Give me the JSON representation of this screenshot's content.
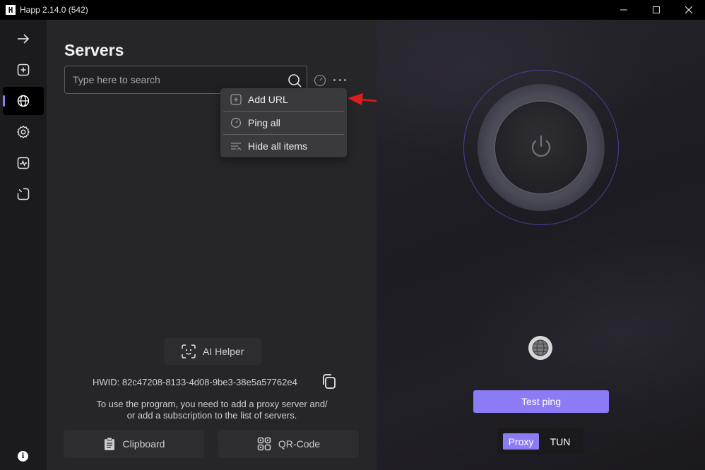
{
  "window": {
    "title": "Happ 2.14.0 (542)",
    "logo_text": "H"
  },
  "colors": {
    "accent": "#8b7cf6",
    "annotation_arrow": "#e01b1b",
    "panel_bg": "#262628",
    "sidebar_bg": "#1b1b1d"
  },
  "sidebar": {
    "items": [
      {
        "icon": "arrow-right-icon",
        "active": false
      },
      {
        "icon": "plus-square-icon",
        "active": false
      },
      {
        "icon": "globe-icon",
        "active": true
      },
      {
        "icon": "gear-icon",
        "active": false
      },
      {
        "icon": "activity-icon",
        "active": false
      },
      {
        "icon": "timer-icon",
        "active": false
      }
    ],
    "info_glyph": "i"
  },
  "servers": {
    "title": "Servers",
    "search_placeholder": "Type here to search"
  },
  "menu": {
    "items": [
      {
        "label": "Add URL",
        "icon": "add-box-icon"
      },
      {
        "label": "Ping all",
        "icon": "gauge-icon"
      },
      {
        "label": "Hide all items",
        "icon": "hide-list-icon"
      }
    ]
  },
  "empty_state": {
    "ai_helper_label": "AI Helper",
    "hwid_text": "HWID: 82c47208-8133-4d08-9be3-38e5a57762e4",
    "hint_line1": "To use the program, you need to add a proxy server and/",
    "hint_line2": "or add a subscription to the list of servers.",
    "clipboard_label": "Clipboard",
    "qrcode_label": "QR-Code"
  },
  "connection": {
    "test_ping_label": "Test ping",
    "mode_options": [
      "Proxy",
      "TUN"
    ],
    "selected_mode": "Proxy"
  }
}
